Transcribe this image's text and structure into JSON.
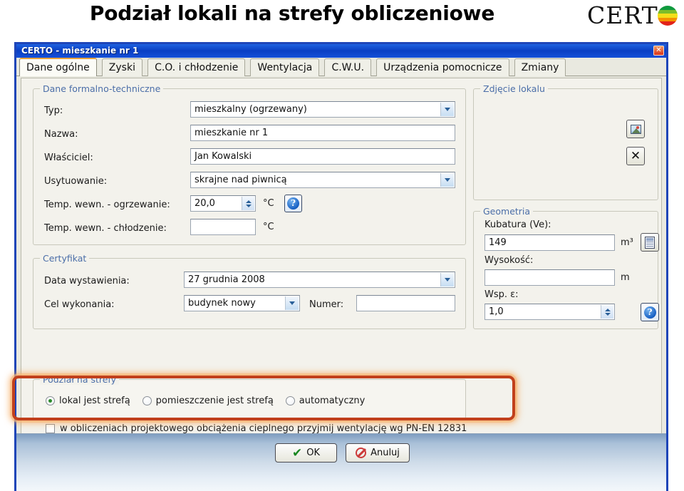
{
  "header": {
    "title": "Podział lokali na strefy obliczeniowe",
    "logo_text": "CERT",
    "logo_mark": "energy-label-circle"
  },
  "window": {
    "title": "CERTO - mieszkanie nr 1",
    "close_label": "✕"
  },
  "tabs": [
    {
      "label": "Dane ogólne",
      "active": true
    },
    {
      "label": "Zyski",
      "active": false
    },
    {
      "label": "C.O. i chłodzenie",
      "active": false
    },
    {
      "label": "Wentylacja",
      "active": false
    },
    {
      "label": "C.W.U.",
      "active": false
    },
    {
      "label": "Urządzenia pomocnicze",
      "active": false
    },
    {
      "label": "Zmiany",
      "active": false
    }
  ],
  "formal": {
    "legend": "Dane formalno-techniczne",
    "typ_label": "Typ:",
    "typ_value": "mieszkalny (ogrzewany)",
    "nazwa_label": "Nazwa:",
    "nazwa_value": "mieszkanie nr 1",
    "wlasciciel_label": "Właściciel:",
    "wlasciciel_value": "Jan Kowalski",
    "usytuowanie_label": "Usytuowanie:",
    "usytuowanie_value": "skrajne nad piwnicą",
    "temp_ogrz_label": "Temp. wewn. - ogrzewanie:",
    "temp_ogrz_value": "20,0",
    "temp_ogrz_unit": "°C",
    "temp_chlodz_label": "Temp. wewn. - chłodzenie:",
    "temp_chlodz_value": "",
    "temp_chlodz_unit": "°C",
    "help_glyph": "?"
  },
  "certyfikat": {
    "legend": "Certyfikat",
    "data_label": "Data wystawienia:",
    "data_value": "27     grudnia     2008",
    "cel_label": "Cel wykonania:",
    "cel_value": "budynek nowy",
    "numer_label": "Numer:",
    "numer_value": ""
  },
  "zdjecie": {
    "legend": "Zdjęcie lokalu",
    "load_icon": "picture-icon",
    "delete_icon": "x-icon"
  },
  "geometria": {
    "legend": "Geometria",
    "kubatura_label": "Kubatura (Ve):",
    "kubatura_value": "149",
    "kubatura_unit": "m³",
    "wysokosc_label": "Wysokość:",
    "wysokosc_value": "",
    "wysokosc_unit": "m",
    "wsp_label": "Wsp. ε:",
    "wsp_value": "1,0",
    "calc_icon": "calculator-icon",
    "help_glyph": "?"
  },
  "podzial": {
    "legend": "Podział na strefy",
    "options": [
      {
        "label": "lokal jest strefą",
        "selected": true
      },
      {
        "label": "pomieszczenie jest strefą",
        "selected": false
      },
      {
        "label": "automatyczny",
        "selected": false
      }
    ],
    "highlight_color": "#c1401c"
  },
  "vent_checkbox": {
    "label": "w obliczeniach projektowego obciążenia cieplnego przyjmij wentylację wg PN-EN 12831",
    "checked": false
  },
  "footer": {
    "ok_label": "OK",
    "cancel_label": "Anuluj"
  }
}
